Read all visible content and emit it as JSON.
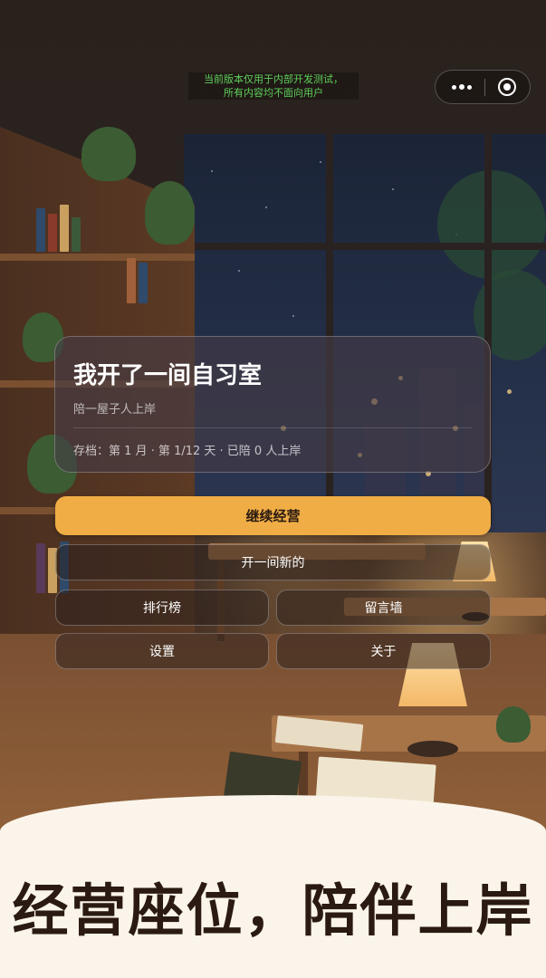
{
  "notice": {
    "line1": "当前版本仅用于内部开发测试，",
    "line2": "所有内容均不面向用户"
  },
  "capsule": {
    "more_icon": "more-dots-icon",
    "close_icon": "target-close-icon"
  },
  "card": {
    "title": "我开了一间自习室",
    "subtitle": "陪一屋子人上岸",
    "meta": "存档：第 1 月 · 第 1/12 天 · 已陪 0 人上岸"
  },
  "buttons": {
    "continue": "继续经营",
    "new_game": "开一间新的",
    "leaderboard": "排行榜",
    "message_wall": "留言墙",
    "settings": "设置",
    "about": "关于"
  },
  "slogan": "经营座位，陪伴上岸",
  "colors": {
    "accent": "#f0ad45",
    "notice_green": "#5fd05a",
    "banner_bg": "#fbf4ea",
    "slogan_text": "#2a1a12"
  }
}
